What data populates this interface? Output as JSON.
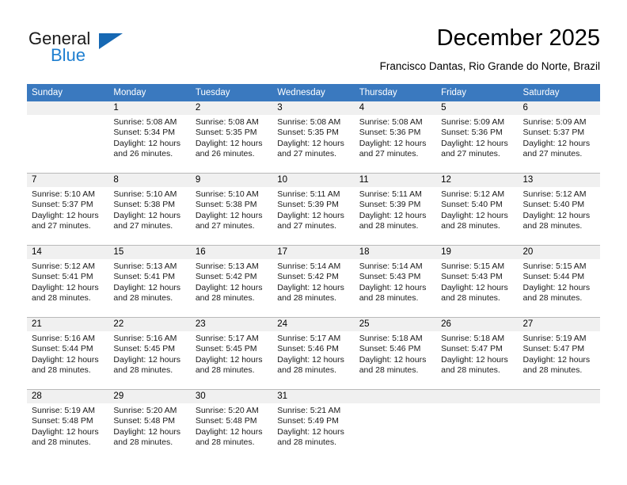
{
  "logo": {
    "word_one": "General",
    "word_two": "Blue",
    "triangle_color": "#1668b3",
    "blue_color": "#1f7fd0"
  },
  "header": {
    "month_title": "December 2025",
    "location": "Francisco Dantas, Rio Grande do Norte, Brazil"
  },
  "theme": {
    "header_bg": "#3a79bf",
    "header_text": "#ffffff",
    "daynum_bg": "#f0f0f0",
    "grid_line": "#b9b9b9"
  },
  "weekday_headers": [
    "Sunday",
    "Monday",
    "Tuesday",
    "Wednesday",
    "Thursday",
    "Friday",
    "Saturday"
  ],
  "weeks": [
    {
      "days": [
        {
          "number": "",
          "blank": true,
          "sunrise": "",
          "sunset": "",
          "daylight_line1": "",
          "daylight_line2": ""
        },
        {
          "number": "1",
          "blank": false,
          "sunrise": "Sunrise: 5:08 AM",
          "sunset": "Sunset: 5:34 PM",
          "daylight_line1": "Daylight: 12 hours",
          "daylight_line2": "and 26 minutes."
        },
        {
          "number": "2",
          "blank": false,
          "sunrise": "Sunrise: 5:08 AM",
          "sunset": "Sunset: 5:35 PM",
          "daylight_line1": "Daylight: 12 hours",
          "daylight_line2": "and 26 minutes."
        },
        {
          "number": "3",
          "blank": false,
          "sunrise": "Sunrise: 5:08 AM",
          "sunset": "Sunset: 5:35 PM",
          "daylight_line1": "Daylight: 12 hours",
          "daylight_line2": "and 27 minutes."
        },
        {
          "number": "4",
          "blank": false,
          "sunrise": "Sunrise: 5:08 AM",
          "sunset": "Sunset: 5:36 PM",
          "daylight_line1": "Daylight: 12 hours",
          "daylight_line2": "and 27 minutes."
        },
        {
          "number": "5",
          "blank": false,
          "sunrise": "Sunrise: 5:09 AM",
          "sunset": "Sunset: 5:36 PM",
          "daylight_line1": "Daylight: 12 hours",
          "daylight_line2": "and 27 minutes."
        },
        {
          "number": "6",
          "blank": false,
          "sunrise": "Sunrise: 5:09 AM",
          "sunset": "Sunset: 5:37 PM",
          "daylight_line1": "Daylight: 12 hours",
          "daylight_line2": "and 27 minutes."
        }
      ]
    },
    {
      "days": [
        {
          "number": "7",
          "blank": false,
          "sunrise": "Sunrise: 5:10 AM",
          "sunset": "Sunset: 5:37 PM",
          "daylight_line1": "Daylight: 12 hours",
          "daylight_line2": "and 27 minutes."
        },
        {
          "number": "8",
          "blank": false,
          "sunrise": "Sunrise: 5:10 AM",
          "sunset": "Sunset: 5:38 PM",
          "daylight_line1": "Daylight: 12 hours",
          "daylight_line2": "and 27 minutes."
        },
        {
          "number": "9",
          "blank": false,
          "sunrise": "Sunrise: 5:10 AM",
          "sunset": "Sunset: 5:38 PM",
          "daylight_line1": "Daylight: 12 hours",
          "daylight_line2": "and 27 minutes."
        },
        {
          "number": "10",
          "blank": false,
          "sunrise": "Sunrise: 5:11 AM",
          "sunset": "Sunset: 5:39 PM",
          "daylight_line1": "Daylight: 12 hours",
          "daylight_line2": "and 27 minutes."
        },
        {
          "number": "11",
          "blank": false,
          "sunrise": "Sunrise: 5:11 AM",
          "sunset": "Sunset: 5:39 PM",
          "daylight_line1": "Daylight: 12 hours",
          "daylight_line2": "and 28 minutes."
        },
        {
          "number": "12",
          "blank": false,
          "sunrise": "Sunrise: 5:12 AM",
          "sunset": "Sunset: 5:40 PM",
          "daylight_line1": "Daylight: 12 hours",
          "daylight_line2": "and 28 minutes."
        },
        {
          "number": "13",
          "blank": false,
          "sunrise": "Sunrise: 5:12 AM",
          "sunset": "Sunset: 5:40 PM",
          "daylight_line1": "Daylight: 12 hours",
          "daylight_line2": "and 28 minutes."
        }
      ]
    },
    {
      "days": [
        {
          "number": "14",
          "blank": false,
          "sunrise": "Sunrise: 5:12 AM",
          "sunset": "Sunset: 5:41 PM",
          "daylight_line1": "Daylight: 12 hours",
          "daylight_line2": "and 28 minutes."
        },
        {
          "number": "15",
          "blank": false,
          "sunrise": "Sunrise: 5:13 AM",
          "sunset": "Sunset: 5:41 PM",
          "daylight_line1": "Daylight: 12 hours",
          "daylight_line2": "and 28 minutes."
        },
        {
          "number": "16",
          "blank": false,
          "sunrise": "Sunrise: 5:13 AM",
          "sunset": "Sunset: 5:42 PM",
          "daylight_line1": "Daylight: 12 hours",
          "daylight_line2": "and 28 minutes."
        },
        {
          "number": "17",
          "blank": false,
          "sunrise": "Sunrise: 5:14 AM",
          "sunset": "Sunset: 5:42 PM",
          "daylight_line1": "Daylight: 12 hours",
          "daylight_line2": "and 28 minutes."
        },
        {
          "number": "18",
          "blank": false,
          "sunrise": "Sunrise: 5:14 AM",
          "sunset": "Sunset: 5:43 PM",
          "daylight_line1": "Daylight: 12 hours",
          "daylight_line2": "and 28 minutes."
        },
        {
          "number": "19",
          "blank": false,
          "sunrise": "Sunrise: 5:15 AM",
          "sunset": "Sunset: 5:43 PM",
          "daylight_line1": "Daylight: 12 hours",
          "daylight_line2": "and 28 minutes."
        },
        {
          "number": "20",
          "blank": false,
          "sunrise": "Sunrise: 5:15 AM",
          "sunset": "Sunset: 5:44 PM",
          "daylight_line1": "Daylight: 12 hours",
          "daylight_line2": "and 28 minutes."
        }
      ]
    },
    {
      "days": [
        {
          "number": "21",
          "blank": false,
          "sunrise": "Sunrise: 5:16 AM",
          "sunset": "Sunset: 5:44 PM",
          "daylight_line1": "Daylight: 12 hours",
          "daylight_line2": "and 28 minutes."
        },
        {
          "number": "22",
          "blank": false,
          "sunrise": "Sunrise: 5:16 AM",
          "sunset": "Sunset: 5:45 PM",
          "daylight_line1": "Daylight: 12 hours",
          "daylight_line2": "and 28 minutes."
        },
        {
          "number": "23",
          "blank": false,
          "sunrise": "Sunrise: 5:17 AM",
          "sunset": "Sunset: 5:45 PM",
          "daylight_line1": "Daylight: 12 hours",
          "daylight_line2": "and 28 minutes."
        },
        {
          "number": "24",
          "blank": false,
          "sunrise": "Sunrise: 5:17 AM",
          "sunset": "Sunset: 5:46 PM",
          "daylight_line1": "Daylight: 12 hours",
          "daylight_line2": "and 28 minutes."
        },
        {
          "number": "25",
          "blank": false,
          "sunrise": "Sunrise: 5:18 AM",
          "sunset": "Sunset: 5:46 PM",
          "daylight_line1": "Daylight: 12 hours",
          "daylight_line2": "and 28 minutes."
        },
        {
          "number": "26",
          "blank": false,
          "sunrise": "Sunrise: 5:18 AM",
          "sunset": "Sunset: 5:47 PM",
          "daylight_line1": "Daylight: 12 hours",
          "daylight_line2": "and 28 minutes."
        },
        {
          "number": "27",
          "blank": false,
          "sunrise": "Sunrise: 5:19 AM",
          "sunset": "Sunset: 5:47 PM",
          "daylight_line1": "Daylight: 12 hours",
          "daylight_line2": "and 28 minutes."
        }
      ]
    },
    {
      "days": [
        {
          "number": "28",
          "blank": false,
          "sunrise": "Sunrise: 5:19 AM",
          "sunset": "Sunset: 5:48 PM",
          "daylight_line1": "Daylight: 12 hours",
          "daylight_line2": "and 28 minutes."
        },
        {
          "number": "29",
          "blank": false,
          "sunrise": "Sunrise: 5:20 AM",
          "sunset": "Sunset: 5:48 PM",
          "daylight_line1": "Daylight: 12 hours",
          "daylight_line2": "and 28 minutes."
        },
        {
          "number": "30",
          "blank": false,
          "sunrise": "Sunrise: 5:20 AM",
          "sunset": "Sunset: 5:48 PM",
          "daylight_line1": "Daylight: 12 hours",
          "daylight_line2": "and 28 minutes."
        },
        {
          "number": "31",
          "blank": false,
          "sunrise": "Sunrise: 5:21 AM",
          "sunset": "Sunset: 5:49 PM",
          "daylight_line1": "Daylight: 12 hours",
          "daylight_line2": "and 28 minutes."
        },
        {
          "number": "",
          "blank": true,
          "sunrise": "",
          "sunset": "",
          "daylight_line1": "",
          "daylight_line2": ""
        },
        {
          "number": "",
          "blank": true,
          "sunrise": "",
          "sunset": "",
          "daylight_line1": "",
          "daylight_line2": ""
        },
        {
          "number": "",
          "blank": true,
          "sunrise": "",
          "sunset": "",
          "daylight_line1": "",
          "daylight_line2": ""
        }
      ]
    }
  ]
}
